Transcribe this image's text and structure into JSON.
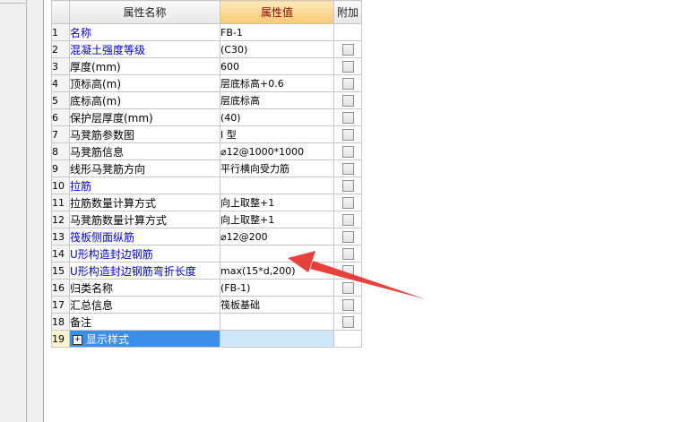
{
  "header": {
    "index_label": "",
    "name_label": "属性名称",
    "value_label": "属性值",
    "extra_label": "附加"
  },
  "rows": [
    {
      "num": "1",
      "name": "名称",
      "value": "FB-1",
      "blue": true,
      "checkbox": false
    },
    {
      "num": "2",
      "name": "混凝土强度等级",
      "value": "(C30)",
      "blue": true,
      "checkbox": true
    },
    {
      "num": "3",
      "name": "厚度(mm)",
      "value": "600",
      "blue": false,
      "checkbox": true
    },
    {
      "num": "4",
      "name": "顶标高(m)",
      "value": "层底标高+0.6",
      "blue": false,
      "checkbox": true
    },
    {
      "num": "5",
      "name": "底标高(m)",
      "value": "层底标高",
      "blue": false,
      "checkbox": true
    },
    {
      "num": "6",
      "name": "保护层厚度(mm)",
      "value": "(40)",
      "blue": false,
      "checkbox": true
    },
    {
      "num": "7",
      "name": "马凳筋参数图",
      "value": "I 型",
      "blue": false,
      "checkbox": true
    },
    {
      "num": "8",
      "name": "马凳筋信息",
      "value": "⌀12@1000*1000",
      "blue": false,
      "checkbox": true
    },
    {
      "num": "9",
      "name": "线形马凳筋方向",
      "value": "平行横向受力筋",
      "blue": false,
      "checkbox": true
    },
    {
      "num": "10",
      "name": "拉筋",
      "value": "",
      "blue": true,
      "checkbox": true
    },
    {
      "num": "11",
      "name": "拉筋数量计算方式",
      "value": "向上取整+1",
      "blue": false,
      "checkbox": true
    },
    {
      "num": "12",
      "name": "马凳筋数量计算方式",
      "value": "向上取整+1",
      "blue": false,
      "checkbox": true
    },
    {
      "num": "13",
      "name": "筏板侧面纵筋",
      "value": "⌀12@200",
      "blue": true,
      "checkbox": true
    },
    {
      "num": "14",
      "name": "U形构造封边钢筋",
      "value": "",
      "blue": true,
      "checkbox": true
    },
    {
      "num": "15",
      "name": "U形构造封边钢筋弯折长度",
      "value": "max(15*d,200)",
      "blue": true,
      "checkbox": true
    },
    {
      "num": "16",
      "name": "归类名称",
      "value": "(FB-1)",
      "blue": false,
      "checkbox": true
    },
    {
      "num": "17",
      "name": "汇总信息",
      "value": "筏板基础",
      "blue": false,
      "checkbox": true
    },
    {
      "num": "18",
      "name": "备注",
      "value": "",
      "blue": false,
      "checkbox": true
    },
    {
      "num": "19",
      "name": "显示样式",
      "value": "",
      "blue": false,
      "checkbox": false,
      "expandable": true,
      "selected": true
    }
  ],
  "annotation": {
    "color": "#e8413c",
    "icon": "red-arrow"
  }
}
